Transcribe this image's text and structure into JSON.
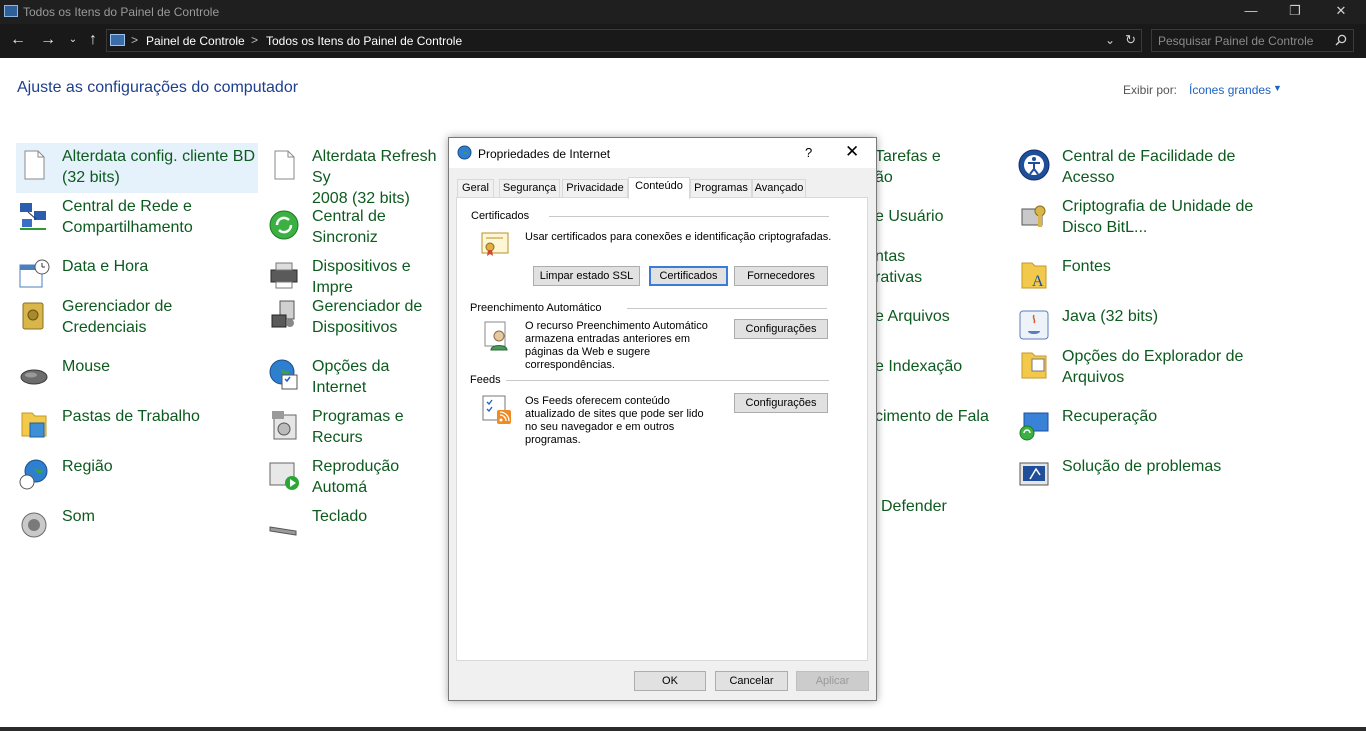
{
  "window": {
    "title": "Todos os Itens do Painel de Controle",
    "minimize": "—",
    "restore": "❐",
    "close": "✕"
  },
  "address": {
    "breadcrumbs": [
      "Painel de Controle",
      "Todos os Itens do Painel de Controle"
    ],
    "separator": ">",
    "search_placeholder": "Pesquisar Painel de Controle"
  },
  "content": {
    "heading": "Ajuste as configurações do computador",
    "view_by_label": "Exibir por:",
    "view_by_value": "Ícones grandes",
    "items_col1": [
      "Alterdata config. cliente BD\n(32 bits)",
      "Central de Rede e\nCompartilhamento",
      "Data e Hora",
      "Gerenciador de\nCredenciais",
      "Mouse",
      "Pastas de Trabalho",
      "Região",
      "Som"
    ],
    "items_col2": [
      "Alterdata Refresh Sy\n2008 (32 bits)",
      "Central de Sincroniz",
      "Dispositivos e Impre",
      "Gerenciador de\nDispositivos",
      "Opções da Internet",
      "Programas e Recurs",
      "Reprodução Automá",
      "Teclado"
    ],
    "items_col3_partial": [
      "Tarefas e\não",
      "e Usuário",
      "ntas\nrativas",
      "e Arquivos",
      "e Indexação",
      "cimento de Fala",
      "Defender"
    ],
    "items_col4": [
      "Central de Facilidade de\nAcesso",
      "Criptografia de Unidade de\nDisco BitL...",
      "Fontes",
      "Java (32 bits)",
      "Opções do Explorador de\nArquivos",
      "Recuperação",
      "Solução de problemas"
    ]
  },
  "dialog": {
    "title": "Propriedades de Internet",
    "help": "?",
    "close": "✕",
    "tabs": [
      "Geral",
      "Segurança",
      "Privacidade",
      "Conteúdo",
      "Programas",
      "Avançado"
    ],
    "active_tab": "Conteúdo",
    "certificates": {
      "label": "Certificados",
      "text": "Usar certificados para conexões e identificação criptografadas.",
      "clear_ssl": "Limpar estado SSL",
      "certificates_btn": "Certificados",
      "publishers_btn": "Fornecedores"
    },
    "autocomplete": {
      "label": "Preenchimento Automático",
      "text": "O recurso Preenchimento Automático armazena entradas anteriores em páginas da Web e sugere correspondências.",
      "settings_btn": "Configurações"
    },
    "feeds": {
      "label": "Feeds",
      "text": "Os Feeds oferecem conteúdo atualizado de sites que pode ser lido no seu navegador e em outros programas.",
      "settings_btn": "Configurações"
    },
    "ok": "OK",
    "cancel": "Cancelar",
    "apply": "Aplicar"
  }
}
